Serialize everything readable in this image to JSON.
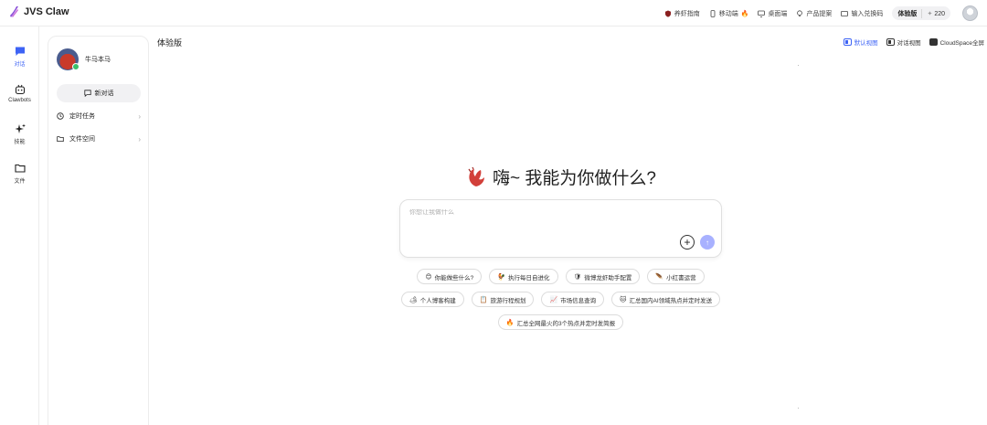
{
  "app": {
    "name": "JVS Claw"
  },
  "topbar": {
    "links": [
      {
        "label": "养虾指南",
        "icon": "shield-icon"
      },
      {
        "label": "移动端",
        "icon": "phone-icon"
      },
      {
        "label": "桌面端",
        "icon": "monitor-icon"
      },
      {
        "label": "产品提案",
        "icon": "lightbulb-icon"
      },
      {
        "label": "输入兑换码",
        "icon": "ticket-icon"
      }
    ],
    "plan": "体验版",
    "points": "220"
  },
  "rail": [
    {
      "label": "对话",
      "icon": "chat-icon",
      "active": true
    },
    {
      "label": "Clawbots",
      "icon": "bot-icon",
      "active": false
    },
    {
      "label": "技能",
      "icon": "sparkle-icon",
      "active": false
    },
    {
      "label": "文件",
      "icon": "folder-icon",
      "active": false
    }
  ],
  "panel": {
    "user_name": "牛马本马",
    "new_chat": "新对话",
    "nav": [
      {
        "label": "定时任务",
        "icon": "clock-icon"
      },
      {
        "label": "文件空间",
        "icon": "folder-icon"
      }
    ]
  },
  "main": {
    "title": "体验版",
    "views": [
      {
        "label": "默认视图",
        "active": true
      },
      {
        "label": "对话视图",
        "active": false
      },
      {
        "label": "CloudSpace全屏",
        "active": false
      }
    ],
    "greeting": "嗨~ 我能为你做什么?",
    "input_placeholder": "你想让我做什么",
    "suggestions": [
      [
        {
          "emoji": "😊",
          "label": "你能做些什么?"
        },
        {
          "emoji": "🐓",
          "label": "执行每日自进化"
        },
        {
          "emoji": "🛡",
          "label": "微博龙虾助手配置"
        },
        {
          "emoji": "🪶",
          "label": "小红書运营"
        }
      ],
      [
        {
          "emoji": "🏕",
          "label": "个人博客构建"
        },
        {
          "emoji": "📋",
          "label": "旅游行程规划"
        },
        {
          "emoji": "📈",
          "label": "市场信息查询"
        },
        {
          "emoji": "🐱",
          "label": "汇总国内AI领域热点并定时发送"
        }
      ],
      [
        {
          "emoji": "🔥",
          "label": "汇总全网最火的3个热点并定时发简报"
        }
      ]
    ]
  },
  "colors": {
    "accent": "#3d63f5",
    "send": "#a8b1ff",
    "brand": "#8a4fd8"
  }
}
